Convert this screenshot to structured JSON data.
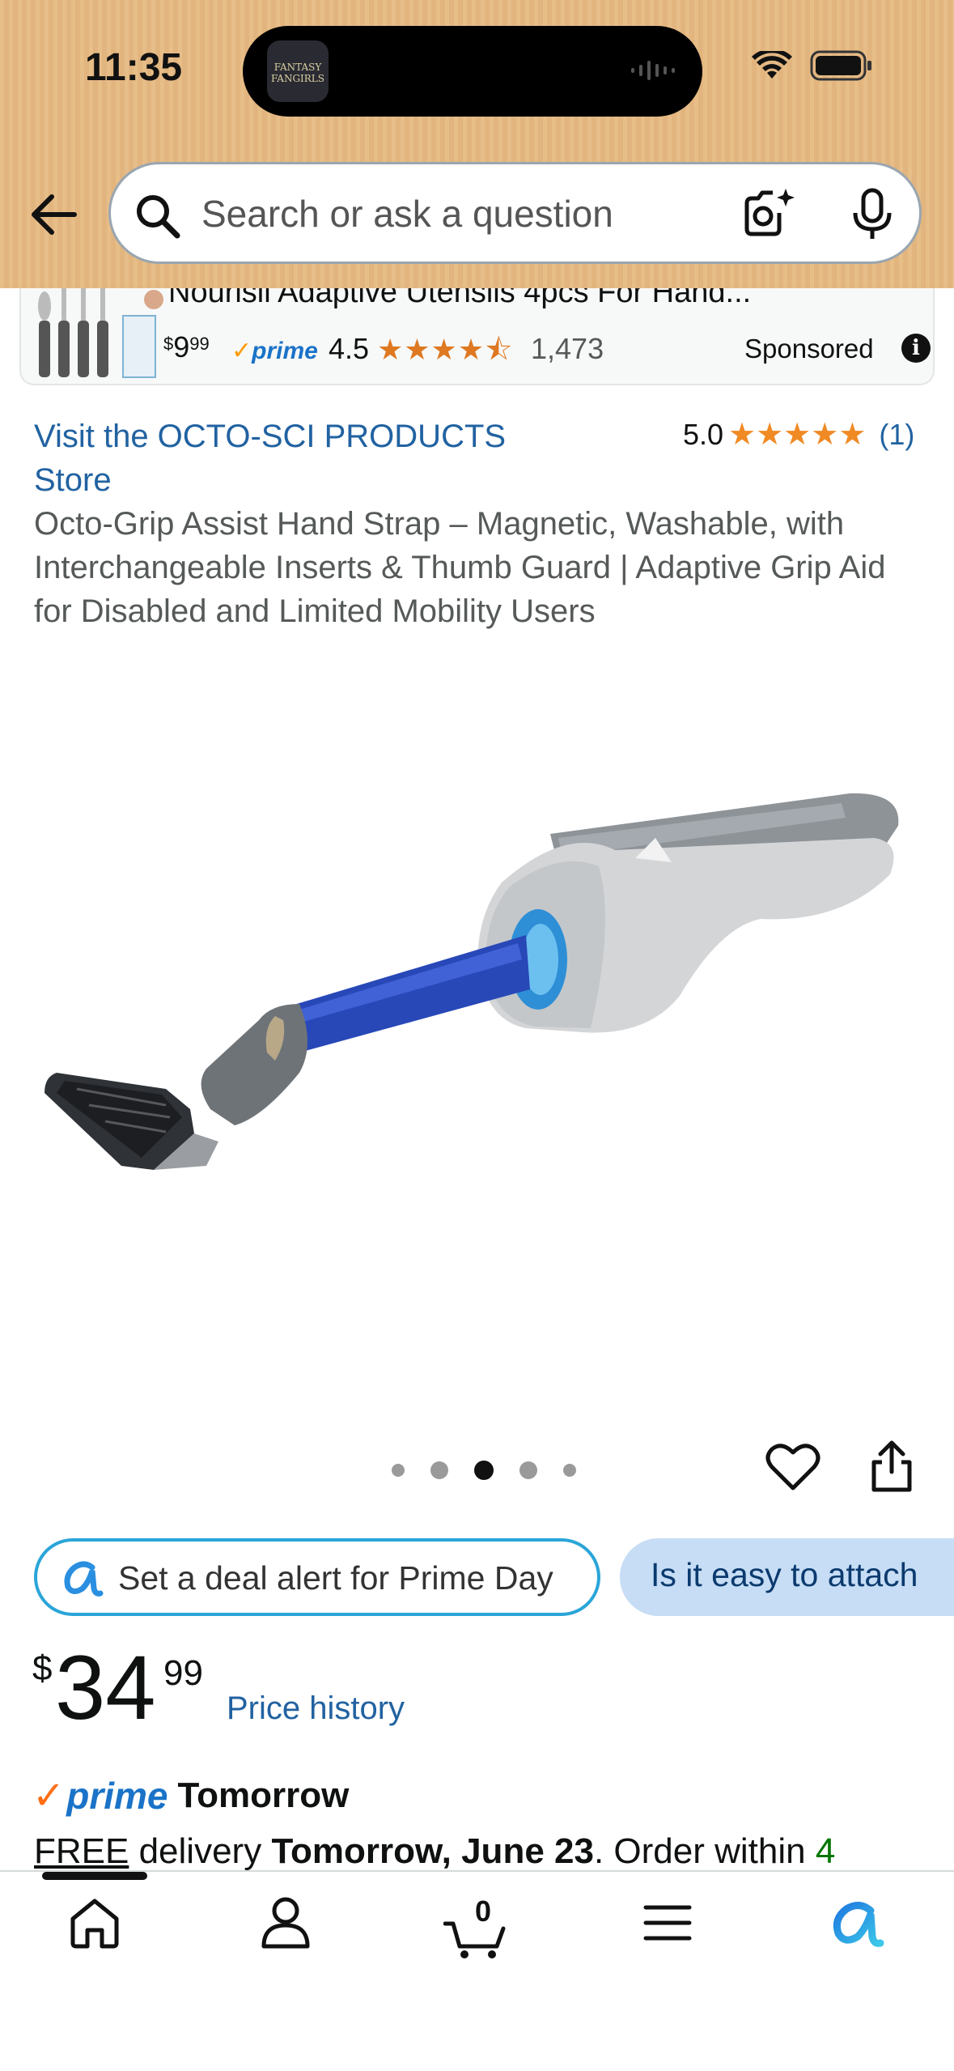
{
  "status_bar": {
    "time": "11:35",
    "island_app": "FANTASY FANGIRLS"
  },
  "search": {
    "placeholder": "Search or ask a question"
  },
  "sponsored_ad": {
    "title": "Nourisil Adaptive Utensils 4pcs For Hand...",
    "price_whole": "9",
    "price_fraction": "99",
    "currency": "$",
    "prime_label": "prime",
    "rating": "4.5",
    "rating_stars": 4.5,
    "review_count": "1,473",
    "sponsored_label": "Sponsored"
  },
  "product": {
    "store_link": "Visit the OCTO-SCI PRODUCTS Store",
    "rating": "5.0",
    "rating_stars": 5,
    "review_count": "(1)",
    "title": "Octo-Grip Assist Hand Strap – Magnetic, Washable, with Interchangeable Inserts & Thumb Guard | Adaptive Grip Aid for Disabled and Limited Mobility Users",
    "image_count": 5,
    "active_image_index": 2
  },
  "chips": [
    {
      "label": "Set a deal alert for Prime Day"
    },
    {
      "label": "Is it easy to attach"
    }
  ],
  "price": {
    "currency": "$",
    "whole": "34",
    "fraction": "99",
    "history_link": "Price history"
  },
  "delivery": {
    "prime_label": "prime",
    "speed": "Tomorrow",
    "free_text": "FREE",
    "delivery_word": " delivery ",
    "date": "Tomorrow, June 23",
    "order_within": ". Order within ",
    "time_left": "4"
  },
  "bottom_nav": {
    "cart_count": "0"
  },
  "colors": {
    "link": "#2162a1",
    "star": "#f08a24",
    "prime_blue": "#1a73c8",
    "header_bg": "#e7bd88"
  }
}
